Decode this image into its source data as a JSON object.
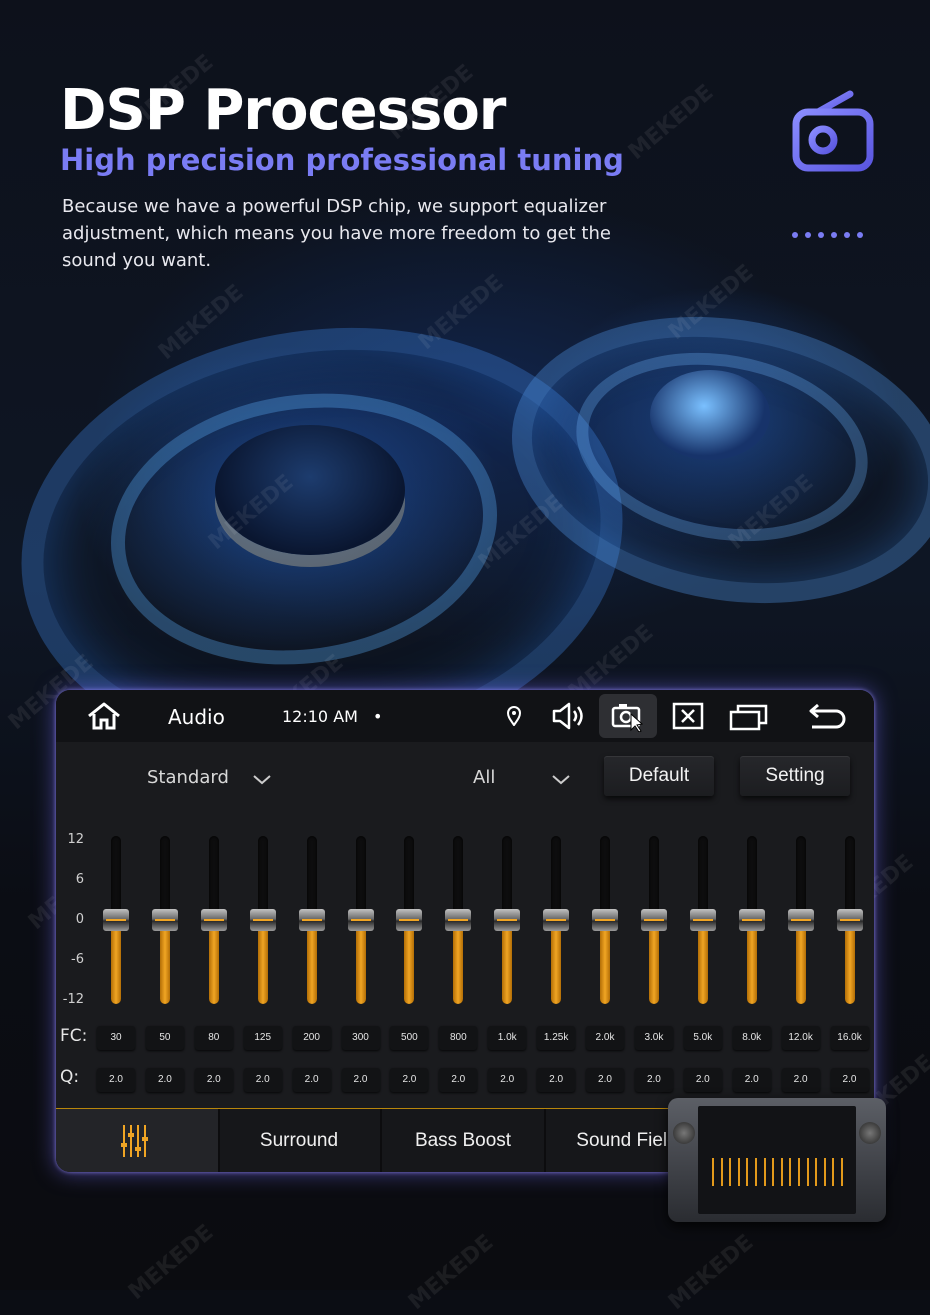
{
  "header": {
    "title": "DSP Processor",
    "subtitle": "High precision professional tuning",
    "description": "Because we have a powerful DSP chip, we support equalizer adjustment, which means you have more freedom to get the sound you want.",
    "accent_color": "#7a7cf4"
  },
  "topbar": {
    "app_name": "Audio",
    "time": "12:10 AM",
    "dot": "•"
  },
  "controls": {
    "preset_value": "Standard",
    "channel_value": "All",
    "default_label": "Default",
    "setting_label": "Setting"
  },
  "eq": {
    "y_ticks": [
      "12",
      "6",
      "0",
      "-6",
      "-12"
    ],
    "fc_label": "FC:",
    "q_label": "Q:",
    "bands": [
      {
        "fc": "30",
        "q": "2.0",
        "gain": 0
      },
      {
        "fc": "50",
        "q": "2.0",
        "gain": 0
      },
      {
        "fc": "80",
        "q": "2.0",
        "gain": 0
      },
      {
        "fc": "125",
        "q": "2.0",
        "gain": 0
      },
      {
        "fc": "200",
        "q": "2.0",
        "gain": 0
      },
      {
        "fc": "300",
        "q": "2.0",
        "gain": 0
      },
      {
        "fc": "500",
        "q": "2.0",
        "gain": 0
      },
      {
        "fc": "800",
        "q": "2.0",
        "gain": 0
      },
      {
        "fc": "1.0k",
        "q": "2.0",
        "gain": 0
      },
      {
        "fc": "1.25k",
        "q": "2.0",
        "gain": 0
      },
      {
        "fc": "2.0k",
        "q": "2.0",
        "gain": 0
      },
      {
        "fc": "3.0k",
        "q": "2.0",
        "gain": 0
      },
      {
        "fc": "5.0k",
        "q": "2.0",
        "gain": 0
      },
      {
        "fc": "8.0k",
        "q": "2.0",
        "gain": 0
      },
      {
        "fc": "12.0k",
        "q": "2.0",
        "gain": 0
      },
      {
        "fc": "16.0k",
        "q": "2.0",
        "gain": 0
      }
    ],
    "fill_color": "#f0a524"
  },
  "tabs": [
    {
      "label": "",
      "icon": "equalizer-icon",
      "active": true
    },
    {
      "label": "Surround"
    },
    {
      "label": "Bass Boost"
    },
    {
      "label": "Sound Field"
    }
  ],
  "watermark": "MEKEDE"
}
